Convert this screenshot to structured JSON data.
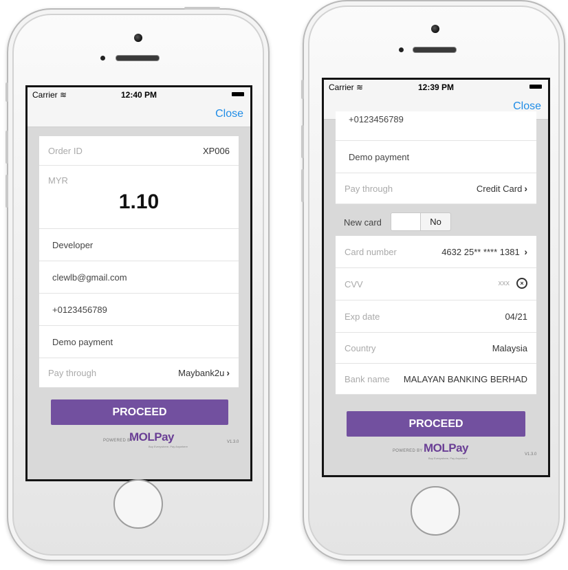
{
  "left_screen": {
    "status_bar": {
      "carrier": "Carrier",
      "time": "12:40 PM"
    },
    "close_label": "Close",
    "order_id_label": "Order ID",
    "order_id_value": "XP006",
    "currency": "MYR",
    "amount": "1.10",
    "name": "Developer",
    "email": "clewlb@gmail.com",
    "phone": "+0123456789",
    "description": "Demo payment",
    "pay_through_label": "Pay through",
    "pay_through_value": "Maybank2u",
    "proceed_label": "PROCEED",
    "powered_by": "POWERED BY",
    "brand": "MOLPay",
    "tagline": "Buy Everywhere, Pay Anywhere",
    "version": "V1.3.0"
  },
  "right_screen": {
    "status_bar": {
      "carrier": "Carrier",
      "time": "12:39 PM"
    },
    "close_label": "Close",
    "phone": "+0123456789",
    "description": "Demo payment",
    "pay_through_label": "Pay through",
    "pay_through_value": "Credit Card",
    "new_card_label": "New card",
    "new_card_toggle_off": "No",
    "card_number_label": "Card number",
    "card_number_value": "4632 25** **** 1381",
    "cvv_label": "CVV",
    "cvv_placeholder": "xxx",
    "exp_date_label": "Exp date",
    "exp_date_value": "04/21",
    "country_label": "Country",
    "country_value": "Malaysia",
    "bank_name_label": "Bank name",
    "bank_name_value": "MALAYAN BANKING BERHAD",
    "proceed_label": "PROCEED",
    "powered_by": "POWERED BY",
    "brand": "MOLPay",
    "tagline": "Buy Everywhere, Pay Anywhere",
    "version": "V1.3.0"
  },
  "icons": [
    "wifi-icon",
    "battery-icon",
    "chevron-right-icon",
    "clear-icon"
  ],
  "colors": {
    "accent": "#1f8ce6",
    "proceed": "#72509f",
    "brand": "#6a3f95"
  }
}
